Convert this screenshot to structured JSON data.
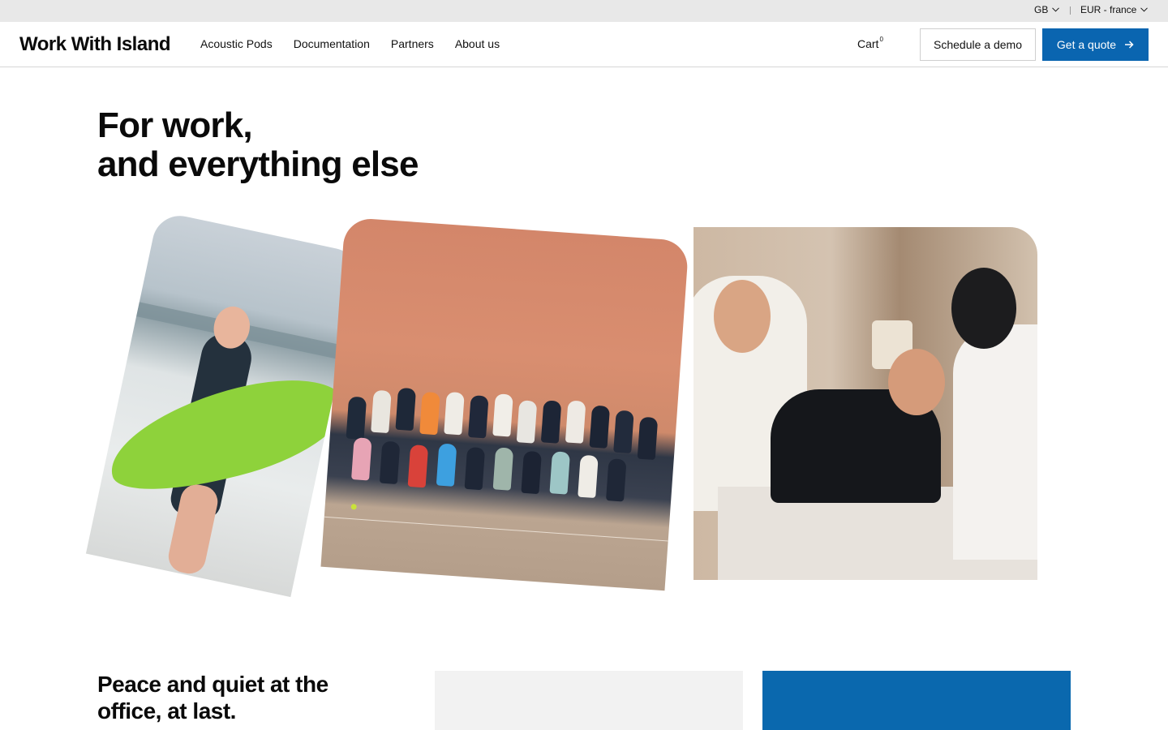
{
  "utility_bar": {
    "language": "GB",
    "currency": "EUR - france"
  },
  "header": {
    "logo": "Work With Island",
    "nav": [
      "Acoustic Pods",
      "Documentation",
      "Partners",
      "About us"
    ],
    "cart_label": "Cart",
    "cart_count": "0",
    "schedule_demo": "Schedule a demo",
    "get_quote": "Get a quote"
  },
  "hero": {
    "title_line1": "For work,",
    "title_line2": "and everything else"
  },
  "section2": {
    "title_line1": "Peace and quiet at the",
    "title_line2": "office, at last."
  },
  "colors": {
    "accent_blue": "#0a65b0",
    "utility_bar_bg": "#e8e8e8"
  },
  "icons": {
    "chevron": "chevron-down-icon",
    "arrow": "arrow-right-icon"
  }
}
